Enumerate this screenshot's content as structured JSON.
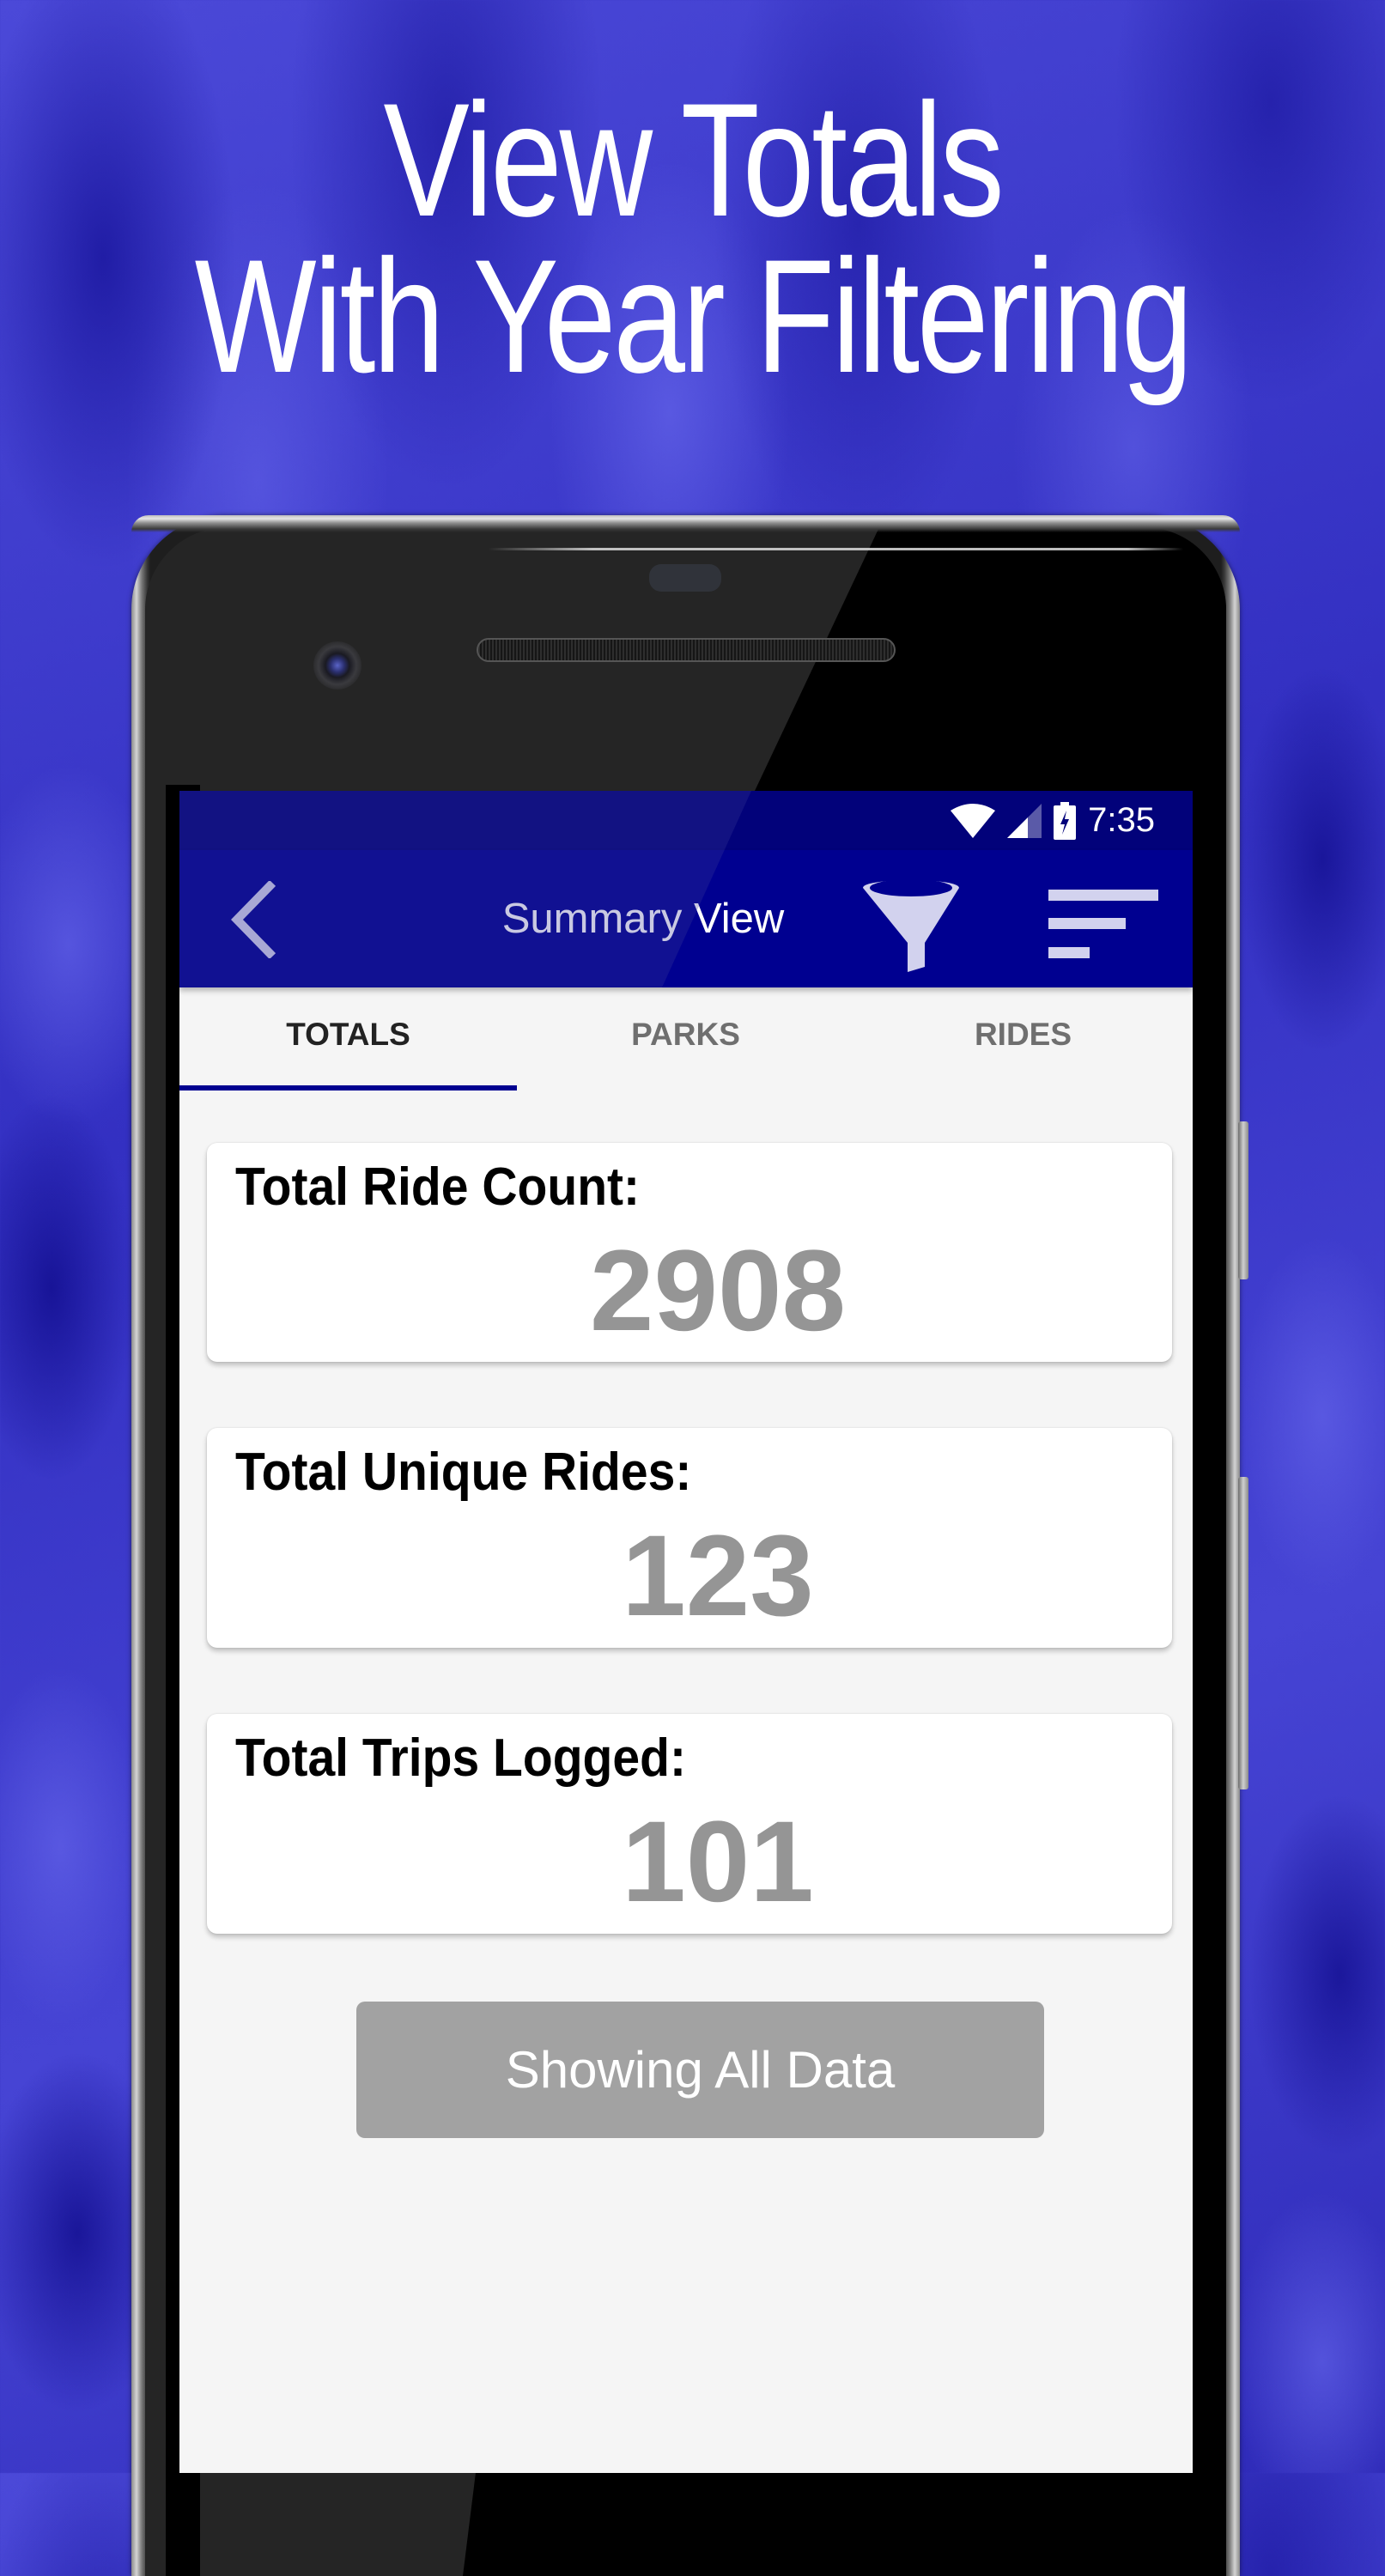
{
  "promo": {
    "headline_line1": "View Totals",
    "headline_line2": "With Year Filtering"
  },
  "status_bar": {
    "time": "7:35",
    "icons": [
      "wifi-icon",
      "cell-signal-icon",
      "battery-charging-icon"
    ]
  },
  "toolbar": {
    "title": "Summary View",
    "back_icon": "chevron-left-icon",
    "filter_icon": "funnel-filter-icon",
    "sort_icon": "sort-lines-icon"
  },
  "tabs": [
    {
      "label": "TOTALS",
      "active": true
    },
    {
      "label": "PARKS",
      "active": false
    },
    {
      "label": "RIDES",
      "active": false
    }
  ],
  "cards": [
    {
      "label": "Total Ride Count:",
      "value": "2908"
    },
    {
      "label": "Total Unique Rides:",
      "value": "123"
    },
    {
      "label": "Total Trips Logged:",
      "value": "101"
    }
  ],
  "filter_button": {
    "label": "Showing All Data"
  },
  "colors": {
    "toolbar": "#000090",
    "status_bar": "#02027a",
    "tab_indicator": "#000090",
    "value_text": "#959595",
    "button_bg": "#a2a2a2",
    "screen_bg": "#f5f5f5"
  }
}
